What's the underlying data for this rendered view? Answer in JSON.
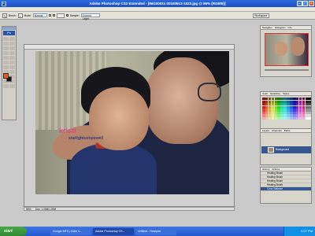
{
  "app": {
    "title": "Adobe Photoshop CS2 Extended - [IMG00011-20100912-1523.jpg @ 96% (RGB/8)]",
    "logo": "Ps"
  },
  "options": {
    "brush_label": "Brush:",
    "mode_label": "Mode:",
    "mode_value": "Normal",
    "opacity_label": "Opacity:",
    "opacity_value": "100%",
    "sample_label": "Sample:",
    "sample_value": "Current Layer",
    "workspace_label": "Workspace"
  },
  "statusbar": {
    "zoom": "96%",
    "doc": "Doc: 1.00M/1.00M"
  },
  "panels": {
    "navigator_tab": "Navigator",
    "histogram_tab": "Histogram",
    "info_tab": "Info",
    "color_tab": "Color",
    "swatches_tab": "Swatches",
    "styles_tab": "Styles",
    "layers_tab": "Layers",
    "channels_tab": "Channels",
    "paths_tab": "Paths",
    "layer_name": "Background",
    "history_tab": "History",
    "actions_tab": "Actions",
    "history_items": [
      "Healing Brush",
      "Healing Brush",
      "Healing Brush",
      "Healing Brush",
      "Color Balance"
    ]
  },
  "watermark": {
    "line1": "kristi",
    "line2": "starlightushpowell"
  },
  "taskbar": {
    "start_label": "start",
    "tasks": [
      "Google MFC) Gallo V...",
      "Adobe Photoshop CS...",
      "Untitled - Notepad"
    ],
    "clock": "4:27 PM"
  },
  "colors": {
    "foreground": "#e85a1a",
    "background": "#111111",
    "selection": "#36588f"
  }
}
